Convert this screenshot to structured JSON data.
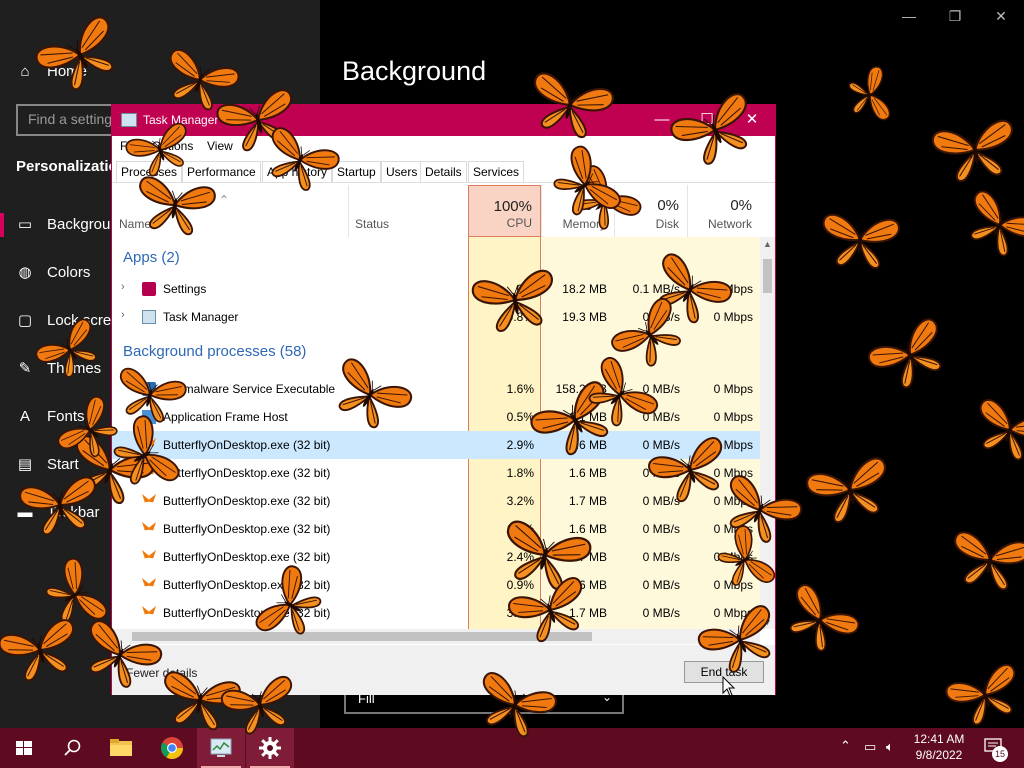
{
  "settings": {
    "nav": {
      "home_label": "Home",
      "search_placeholder": "Find a setting",
      "section_title": "Personalization",
      "items": [
        {
          "label": "Background",
          "icon": "picture-icon"
        },
        {
          "label": "Colors",
          "icon": "palette-icon"
        },
        {
          "label": "Lock screen",
          "icon": "lock-screen-icon"
        },
        {
          "label": "Themes",
          "icon": "themes-icon"
        },
        {
          "label": "Fonts",
          "icon": "fonts-icon"
        },
        {
          "label": "Start",
          "icon": "start-icon"
        },
        {
          "label": "Taskbar",
          "icon": "taskbar-icon"
        }
      ]
    },
    "main": {
      "page_title": "Background",
      "fit_value": "Fill"
    },
    "accent_color": "#d6005d"
  },
  "task_manager": {
    "title": "Task Manager",
    "title_bar_color": "#c00050",
    "menu": [
      "File",
      "Options",
      "View"
    ],
    "tabs": [
      "Processes",
      "Performance",
      "App history",
      "Startup",
      "Users",
      "Details",
      "Services"
    ],
    "columns": {
      "name": {
        "label": "Name"
      },
      "status": {
        "label": "Status"
      },
      "cpu": {
        "label": "CPU",
        "total": "100%"
      },
      "memory": {
        "label": "Memory",
        "total": "50%"
      },
      "disk": {
        "label": "Disk",
        "total": "0%"
      },
      "network": {
        "label": "Network",
        "total": "0%"
      }
    },
    "apps_header": "Apps (2)",
    "background_header": "Background processes (58)",
    "apps": [
      {
        "name": "Settings",
        "icon": "gear-icon",
        "cpu": "0%",
        "memory": "18.2 MB",
        "disk": "0.1 MB/s",
        "network": "0 Mbps"
      },
      {
        "name": "Task Manager",
        "icon": "task-manager-icon",
        "cpu": "0.8%",
        "memory": "19.3 MB",
        "disk": "0 MB/s",
        "network": "0 Mbps"
      }
    ],
    "processes": [
      {
        "name": "Antimalware Service Executable",
        "icon": "shield-icon",
        "cpu": "1.6%",
        "memory": "158.2 MB",
        "disk": "0 MB/s",
        "network": "0 Mbps"
      },
      {
        "name": "Application Frame Host",
        "icon": "app-frame-icon",
        "cpu": "0.5%",
        "memory": "6.1 MB",
        "disk": "0 MB/s",
        "network": "0 Mbps"
      },
      {
        "name": "ButterflyOnDesktop.exe (32 bit)",
        "icon": "butterfly-icon",
        "cpu": "2.9%",
        "memory": "1.6 MB",
        "disk": "0 MB/s",
        "network": "0 Mbps"
      },
      {
        "name": "ButterflyOnDesktop.exe (32 bit)",
        "icon": "butterfly-icon",
        "cpu": "1.8%",
        "memory": "1.6 MB",
        "disk": "0 MB/s",
        "network": "0 Mbps"
      },
      {
        "name": "ButterflyOnDesktop.exe (32 bit)",
        "icon": "butterfly-icon",
        "cpu": "3.2%",
        "memory": "1.7 MB",
        "disk": "0 MB/s",
        "network": "0 Mbps"
      },
      {
        "name": "ButterflyOnDesktop.exe (32 bit)",
        "icon": "butterfly-icon",
        "cpu": "1.9%",
        "memory": "1.6 MB",
        "disk": "0 MB/s",
        "network": "0 Mbps"
      },
      {
        "name": "ButterflyOnDesktop.exe (32 bit)",
        "icon": "butterfly-icon",
        "cpu": "2.4%",
        "memory": "1.7 MB",
        "disk": "0 MB/s",
        "network": "0 Mbps"
      },
      {
        "name": "ButterflyOnDesktop.exe (32 bit)",
        "icon": "butterfly-icon",
        "cpu": "0.9%",
        "memory": "1.6 MB",
        "disk": "0 MB/s",
        "network": "0 Mbps"
      },
      {
        "name": "ButterflyOnDesktop.exe (32 bit)",
        "icon": "butterfly-icon",
        "cpu": "3.0%",
        "memory": "1.7 MB",
        "disk": "0 MB/s",
        "network": "0 Mbps"
      }
    ],
    "selected_index": 2,
    "footer": {
      "fewer_details": "Fewer details",
      "end_task": "End task"
    }
  },
  "taskbar": {
    "color": "#5e0a21",
    "apps": [
      {
        "name": "start-icon"
      },
      {
        "name": "search-icon"
      },
      {
        "name": "file-explorer-icon"
      },
      {
        "name": "chrome-icon"
      },
      {
        "name": "task-manager-icon"
      },
      {
        "name": "settings-icon"
      }
    ],
    "time": "12:41 AM",
    "date": "9/8/2022",
    "notification_count": "15"
  }
}
